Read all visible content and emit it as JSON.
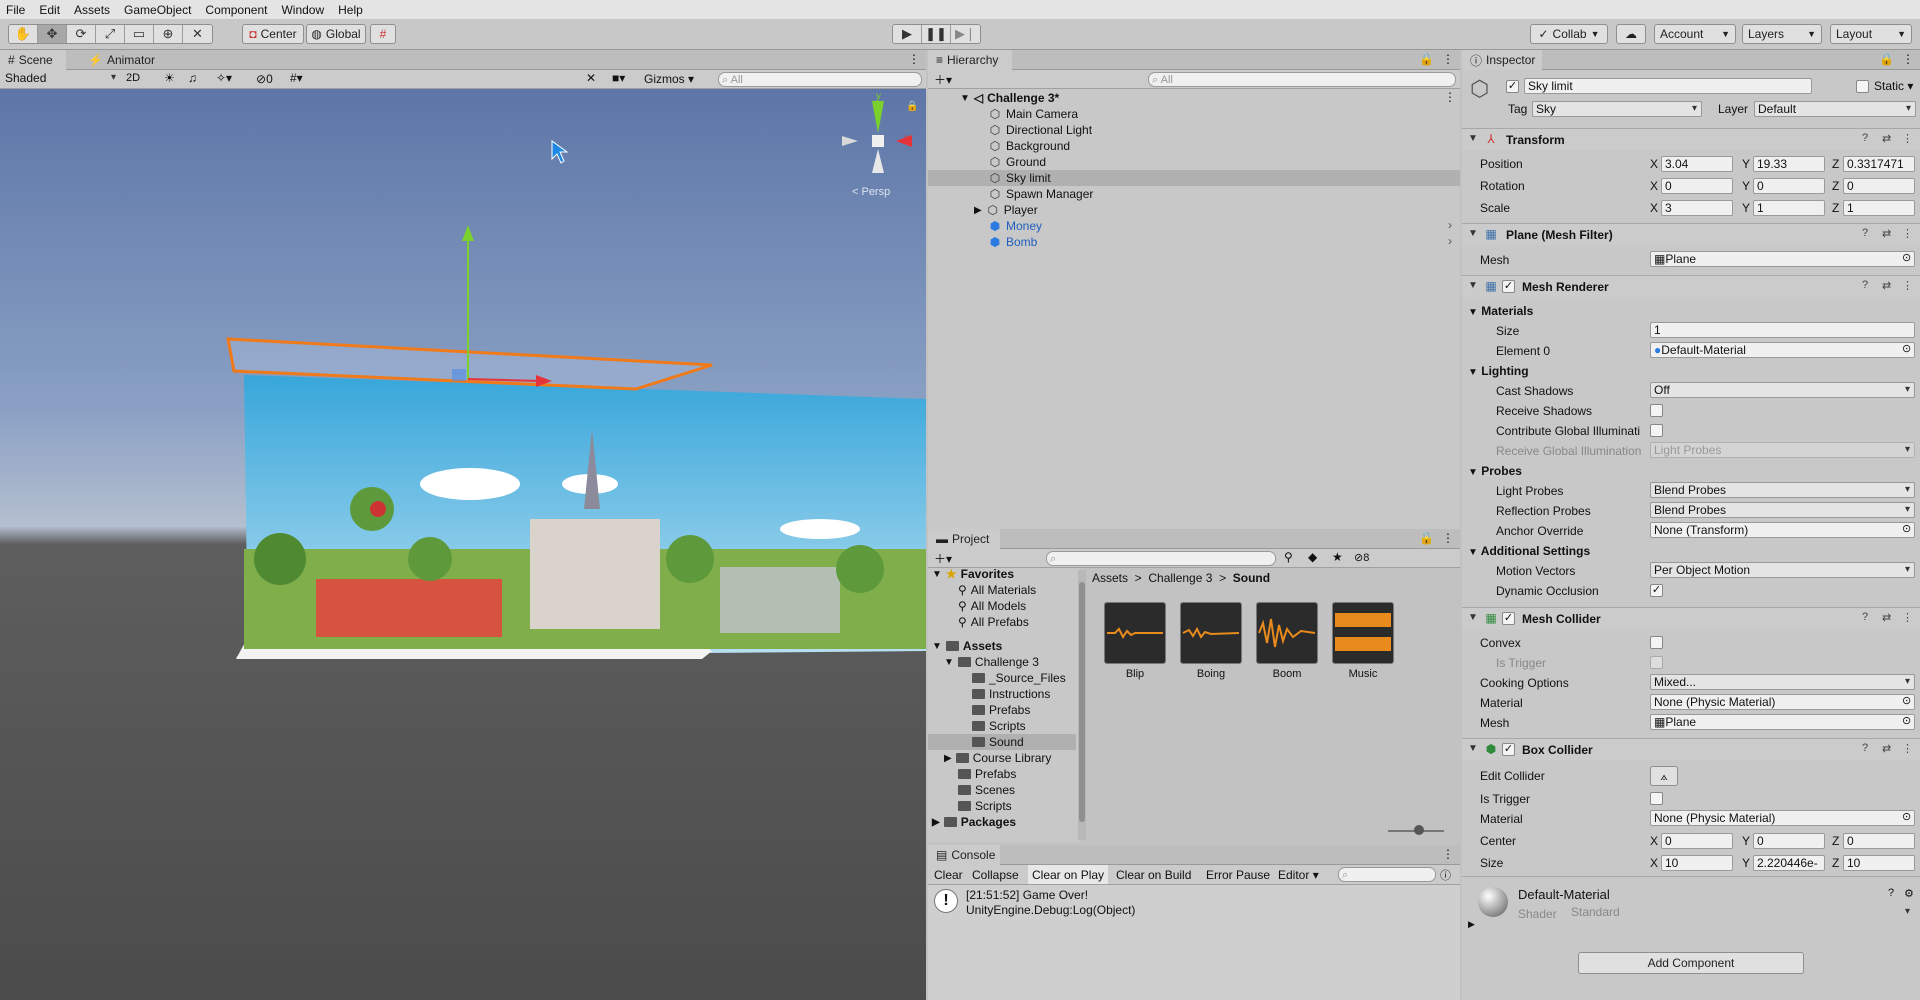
{
  "menubar": [
    "File",
    "Edit",
    "Assets",
    "GameObject",
    "Component",
    "Window",
    "Help"
  ],
  "toolbar": {
    "pivot": "Center",
    "space": "Global",
    "collab": "Collab",
    "account": "Account",
    "layers": "Layers",
    "layout": "Layout"
  },
  "scene": {
    "tabs": [
      "Scene",
      "Animator"
    ],
    "shading": "Shaded",
    "mode_2d": "2D",
    "hidden_count": "0",
    "gizmos": "Gizmos",
    "search_placeholder": "All",
    "persp": "< Persp",
    "axis_y": "y",
    "axis_x": "x"
  },
  "hierarchy": {
    "tab": "Hierarchy",
    "search_placeholder": "All",
    "root": "Challenge 3*",
    "items": [
      {
        "label": "Main Camera",
        "type": "object"
      },
      {
        "label": "Directional Light",
        "type": "object"
      },
      {
        "label": "Background",
        "type": "object"
      },
      {
        "label": "Ground",
        "type": "object"
      },
      {
        "label": "Sky limit",
        "type": "selected"
      },
      {
        "label": "Spawn Manager",
        "type": "object"
      },
      {
        "label": "Player",
        "type": "object"
      },
      {
        "label": "Money",
        "type": "prefab"
      },
      {
        "label": "Bomb",
        "type": "prefab"
      }
    ]
  },
  "project": {
    "tab": "Project",
    "hidden_count": "8",
    "favorites": {
      "label": "Favorites",
      "items": [
        "All Materials",
        "All Models",
        "All Prefabs"
      ]
    },
    "assets": {
      "label": "Assets",
      "challenge": "Challenge 3",
      "challenge_children": [
        "_Source_Files",
        "Instructions",
        "Prefabs",
        "Scripts",
        "Sound"
      ],
      "others": [
        "Course Library",
        "Prefabs",
        "Scenes",
        "Scripts"
      ]
    },
    "packages": "Packages",
    "breadcrumb": [
      "Assets",
      "Challenge 3",
      "Sound"
    ],
    "files": [
      "Blip",
      "Boing",
      "Boom",
      "Music"
    ]
  },
  "console": {
    "tab": "Console",
    "buttons": [
      "Clear",
      "Collapse",
      "Clear on Play",
      "Clear on Build",
      "Error Pause",
      "Editor"
    ],
    "message_line1": "[21:51:52] Game Over!",
    "message_line2": "UnityEngine.Debug:Log(Object)"
  },
  "inspector": {
    "tab": "Inspector",
    "object_name": "Sky limit",
    "static": "Static",
    "tag_label": "Tag",
    "tag": "Sky",
    "layer_label": "Layer",
    "layer": "Default",
    "transform": {
      "title": "Transform",
      "position_label": "Position",
      "position": [
        "3.04",
        "19.33",
        "0.3317471"
      ],
      "rotation_label": "Rotation",
      "rotation": [
        "0",
        "0",
        "0"
      ],
      "scale_label": "Scale",
      "scale": [
        "3",
        "1",
        "1"
      ]
    },
    "mesh_filter": {
      "title": "Plane (Mesh Filter)",
      "mesh_label": "Mesh",
      "mesh": "Plane"
    },
    "mesh_renderer": {
      "title": "Mesh Renderer",
      "materials": "Materials",
      "size_label": "Size",
      "size": "1",
      "element0_label": "Element 0",
      "element0": "Default-Material",
      "lighting": "Lighting",
      "cast_shadows_label": "Cast Shadows",
      "cast_shadows": "Off",
      "receive_shadows_label": "Receive Shadows",
      "contribute_gi_label": "Contribute Global Illuminati",
      "receive_gi_label": "Receive Global Illumination",
      "receive_gi": "Light Probes",
      "probes": "Probes",
      "light_probes_label": "Light Probes",
      "light_probes": "Blend Probes",
      "reflection_probes_label": "Reflection Probes",
      "reflection_probes": "Blend Probes",
      "anchor_label": "Anchor Override",
      "anchor": "None (Transform)",
      "additional": "Additional Settings",
      "motion_label": "Motion Vectors",
      "motion": "Per Object Motion",
      "dynamic_occlusion_label": "Dynamic Occlusion"
    },
    "mesh_collider": {
      "title": "Mesh Collider",
      "convex_label": "Convex",
      "is_trigger_label": "Is Trigger",
      "cooking_label": "Cooking Options",
      "cooking": "Mixed...",
      "material_label": "Material",
      "material": "None (Physic Material)",
      "mesh_label": "Mesh",
      "mesh": "Plane"
    },
    "box_collider": {
      "title": "Box Collider",
      "edit_label": "Edit Collider",
      "is_trigger_label": "Is Trigger",
      "material_label": "Material",
      "material": "None (Physic Material)",
      "center_label": "Center",
      "center": [
        "0",
        "0",
        "0"
      ],
      "size_label": "Size",
      "size": [
        "10",
        "2.220446e-",
        "10"
      ]
    },
    "material": {
      "name": "Default-Material",
      "shader_label": "Shader",
      "shader": "Standard"
    },
    "add_component": "Add Component",
    "axes": [
      "X",
      "Y",
      "Z"
    ]
  }
}
